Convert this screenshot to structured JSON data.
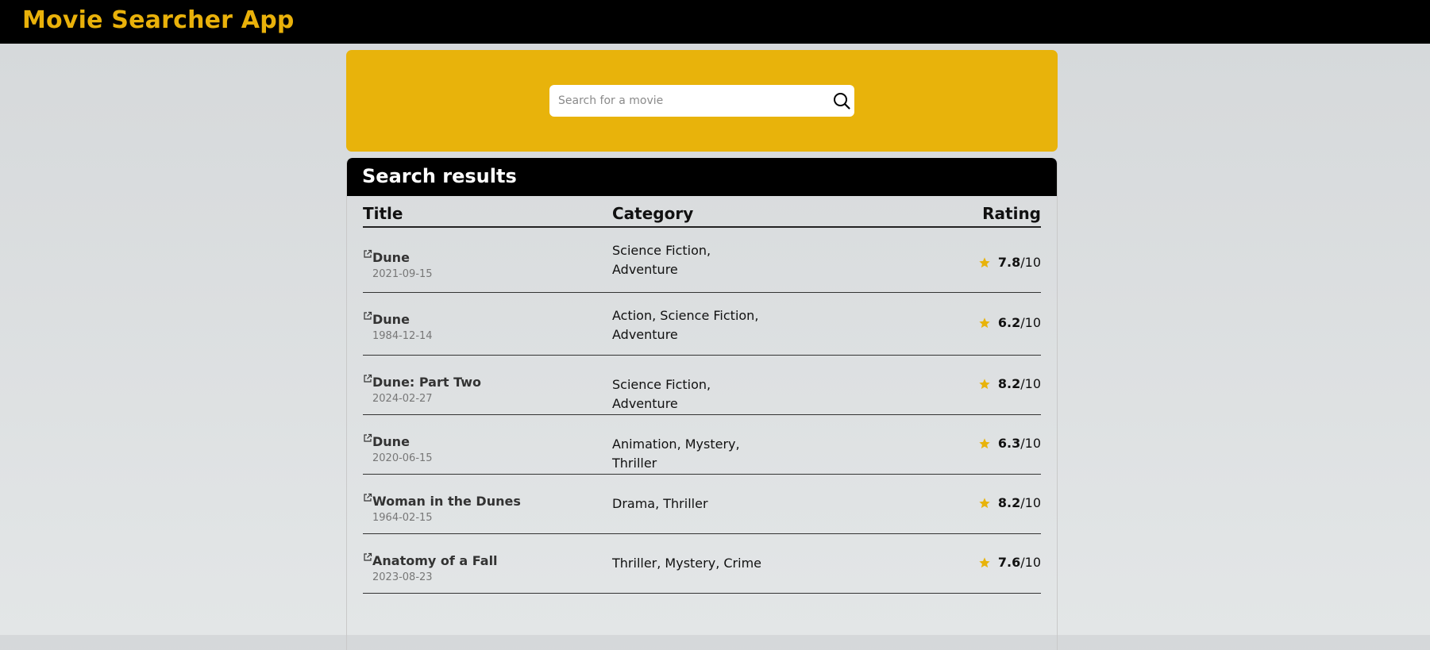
{
  "app": {
    "title": "Movie Searcher App"
  },
  "search": {
    "placeholder": "Search for a movie",
    "value": ""
  },
  "results": {
    "heading": "Search results",
    "columns": {
      "title": "Title",
      "category": "Category",
      "rating": "Rating"
    },
    "rating_suffix": "/10",
    "rows": [
      {
        "title": "Dune",
        "date": "2021-09-15",
        "category": "Science Fiction, Adventure",
        "rating": "7.8"
      },
      {
        "title": "Dune",
        "date": "1984-12-14",
        "category": "Action, Science Fiction, Adventure",
        "rating": "6.2"
      },
      {
        "title": "Dune: Part Two",
        "date": "2024-02-27",
        "category": "Science Fiction, Adventure",
        "rating": "8.2"
      },
      {
        "title": "Dune",
        "date": "2020-06-15",
        "category": "Animation, Mystery, Thriller",
        "rating": "6.3"
      },
      {
        "title": "Woman in the Dunes",
        "date": "1964-02-15",
        "category": "Drama, Thriller",
        "rating": "8.2"
      },
      {
        "title": "Anatomy of a Fall",
        "date": "2023-08-23",
        "category": "Thriller, Mystery, Crime",
        "rating": "7.6"
      }
    ]
  },
  "colors": {
    "accent": "#e8b30b",
    "header": "#000000"
  },
  "icons": {
    "search": "search-icon",
    "external": "external-link-icon",
    "star": "star-icon"
  }
}
